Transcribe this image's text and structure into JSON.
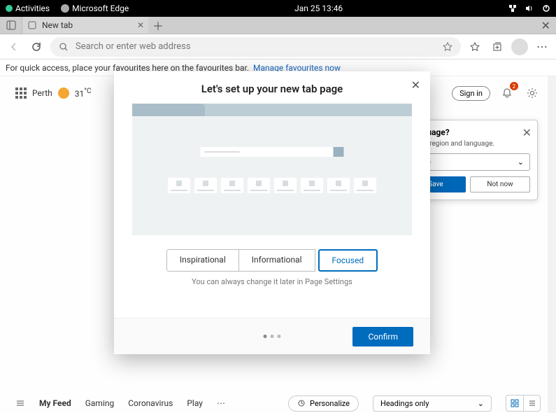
{
  "system": {
    "activities": "Activities",
    "app": "Microsoft Edge",
    "datetime": "Jan 25  13:46"
  },
  "tab": {
    "label": "New tab"
  },
  "toolbar": {
    "placeholder": "Search or enter web address"
  },
  "favbar": {
    "text": "For quick access, place your favourites here on the favourites bar.",
    "link": "Manage favourites now"
  },
  "newtab": {
    "location": "Perth",
    "temp": "31",
    "unit": "°C",
    "signin": "Sign in",
    "notif_count": "2"
  },
  "lang": {
    "title": "t language?",
    "sub": "eferred region and language.",
    "selected": "glish)",
    "save": "Save",
    "not_now": "Not now"
  },
  "modal": {
    "title": "Let's set up your new tab page",
    "tab_inspirational": "Inspirational",
    "tab_informational": "Informational",
    "tab_focused": "Focused",
    "hint": "You can always change it later in Page Settings",
    "confirm": "Confirm"
  },
  "feed": {
    "myfeed": "My Feed",
    "gaming": "Gaming",
    "coronavirus": "Coronavirus",
    "play": "Play",
    "personalize": "Personalize",
    "headings": "Headings only"
  }
}
